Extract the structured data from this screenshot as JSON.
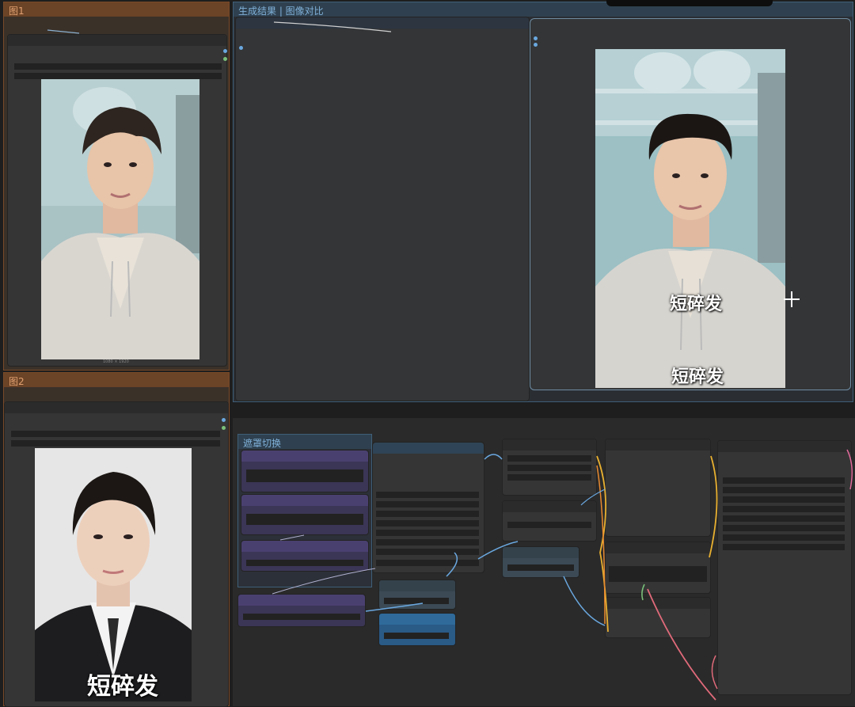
{
  "groups": {
    "image1": {
      "title": "图1",
      "size_label": "1080 × 1920"
    },
    "image2": {
      "title": "图2"
    },
    "result": {
      "title": "生成结果 | 图像对比"
    },
    "bottom_left": {
      "title": "遮罩切换"
    }
  },
  "result_caption_top": "短碎发",
  "result_caption_bottom": "短碎发",
  "image2_caption": "短碎发",
  "colors": {
    "orange_group": "#6b4326",
    "blue_group": "#2f4150",
    "purple_node": "#3b3656",
    "link_yellow": "#e8b030",
    "link_blue": "#6aa8e0",
    "link_pink": "#e06a7a",
    "link_orange": "#e88a30"
  }
}
